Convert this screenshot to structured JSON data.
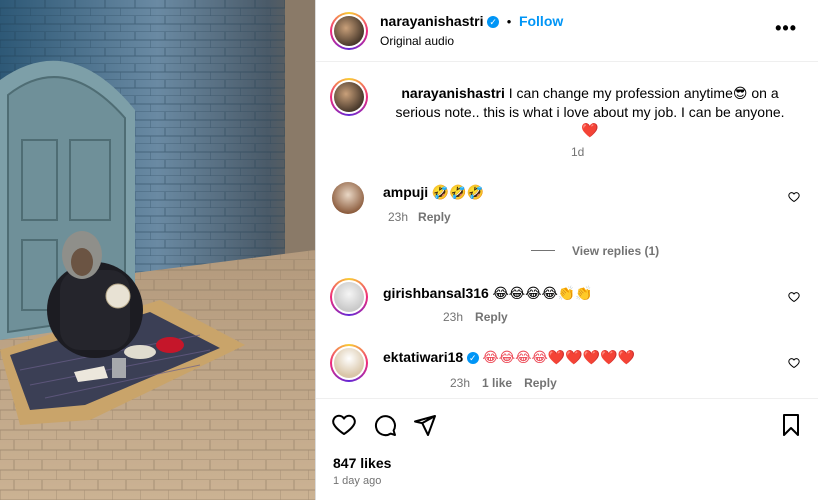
{
  "post": {
    "author": "narayanishastri",
    "follow_label": "Follow",
    "audio": "Original audio",
    "more_label": "•••"
  },
  "caption": {
    "author": "narayanishastri",
    "text_part1": "I can change my profession anytime",
    "emoji1": "😎",
    "text_part2": "on a serious note.. this is what i love about my job. I can be anyone.",
    "emoji2": "❤️",
    "time": "1d"
  },
  "comments": [
    {
      "user": "ampuji",
      "text": "🤣🤣🤣",
      "time": "23h",
      "likes": "",
      "reply": "Reply",
      "verified": false
    },
    {
      "user": "girishbansal316",
      "text": "😂😂😂😂👏👏",
      "time": "23h",
      "likes": "",
      "reply": "Reply",
      "verified": false
    },
    {
      "user": "ektatiwari18",
      "text": "😂😂😂😂❤️❤️❤️❤️❤️",
      "time": "23h",
      "likes": "1 like",
      "reply": "Reply",
      "verified": true
    }
  ],
  "view_replies": "View replies (1)",
  "footer": {
    "likes": "847 likes",
    "posted": "1 day ago"
  },
  "colors": {
    "accent": "#0095f6",
    "heart": "#ed4956",
    "muted": "#737373"
  },
  "icons": [
    "heart-icon",
    "comment-icon",
    "share-icon",
    "bookmark-icon",
    "verified-icon",
    "more-icon"
  ]
}
